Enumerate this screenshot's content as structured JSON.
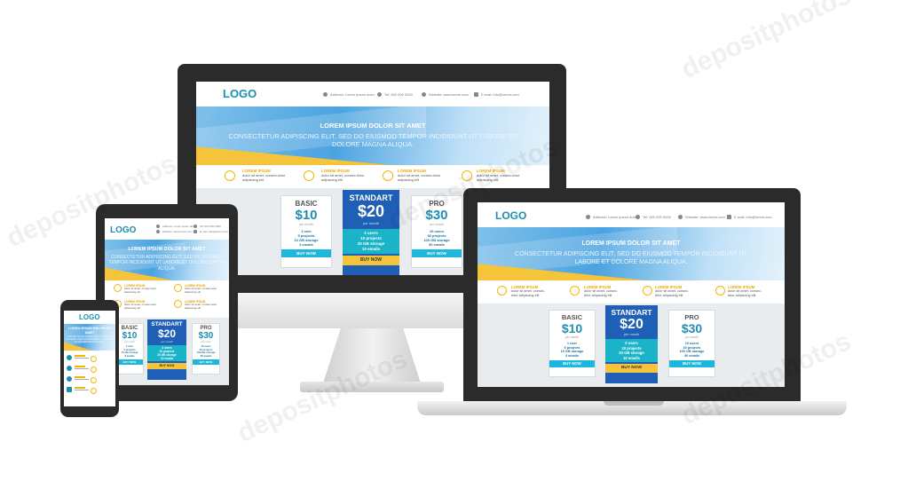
{
  "logo": "LOGO",
  "contacts": {
    "address": "Address: Lorem ipsum dolor",
    "phone": "Tel: 000 000 0000",
    "website": "Website: www.lorem.com",
    "email": "E-mail: info@lorem.com"
  },
  "hero": {
    "title": "LOREM IPSUM DOLOR SIT AMET",
    "subtitle": "CONSECTETUR ADIPISCING ELIT, SED DO EIUSMOD TEMPOR INCIDIDUNT UT LABORE ET DOLORE MAGNA ALIQUA."
  },
  "features": [
    {
      "title": "LOREM IPSUM",
      "text": "dolor sit amet, consec-tetur adipiscing elit",
      "icon": "gear-icon"
    },
    {
      "title": "LOREM IPSUM",
      "text": "dolor sit amet, consec-tetur adipiscing elit",
      "icon": "person-icon"
    },
    {
      "title": "LOREM IPSUM",
      "text": "dolor sit amet, consec-tetur adipiscing elit",
      "icon": "magnifier-icon"
    },
    {
      "title": "LOREM IPSUM",
      "text": "dolor sit amet, consec-tetur adipiscing elit",
      "icon": "lightbulb-icon"
    }
  ],
  "plans": [
    {
      "name": "BASIC",
      "price": "$10",
      "per": "per month",
      "f1": "1 user",
      "f2": "5 projects",
      "f3": "10 GB storage",
      "f4": "3 emails",
      "button": "BUY NOW"
    },
    {
      "name": "STANDART",
      "price": "$20",
      "per": "per month",
      "f1": "3 users",
      "f2": "10 projects",
      "f3": "20 GB storage",
      "f4": "10 emails",
      "button": "BUY NOW"
    },
    {
      "name": "PRO",
      "price": "$30",
      "per": "per month",
      "f1": "10 users",
      "f2": "30 projects",
      "f3": "100 GB storage",
      "f4": "30 emails",
      "button": "BUY NOW"
    }
  ],
  "watermark": "depositphotos",
  "colors": {
    "accent": "#1e8fb0",
    "highlight": "#1f5fb5",
    "yellow": "#f6c43a",
    "button": "#1db6dc",
    "device": "#2b2b2b"
  }
}
